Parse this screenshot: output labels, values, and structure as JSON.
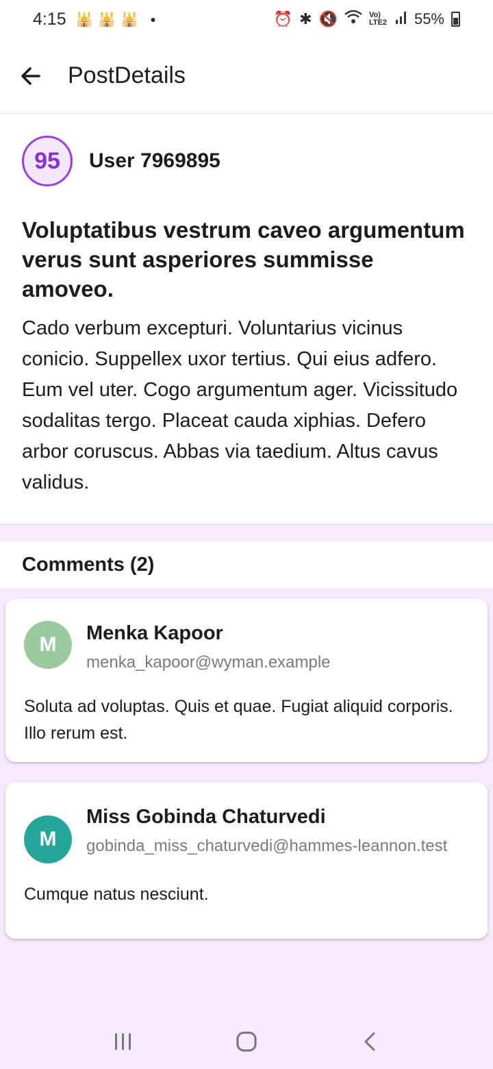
{
  "status_bar": {
    "time": "4:15",
    "network": "Vo) LTE2",
    "battery": "55%"
  },
  "app_bar": {
    "title": "PostDetails"
  },
  "post": {
    "score": "95",
    "user": "User 7969895",
    "title": "Voluptatibus vestrum caveo argumentum verus sunt asperiores summisse amoveo.",
    "body": "Cado verbum excepturi. Voluntarius vicinus conicio. Suppellex uxor tertius. Qui eius adfero. Eum vel uter. Cogo argumentum ager. Vicissitudo sodalitas tergo. Placeat cauda xiphias. Defero arbor coruscus. Abbas via taedium. Altus cavus validus."
  },
  "comments": {
    "header": "Comments (2)",
    "items": [
      {
        "initial": "M",
        "name": "Menka Kapoor",
        "email": "menka_kapoor@wyman.example",
        "text": "Soluta ad voluptas. Quis et quae. Fugiat aliquid corporis. Illo rerum est.",
        "avatar_color": "#9ccaa0"
      },
      {
        "initial": "M",
        "name": "Miss Gobinda Chaturvedi",
        "email": "gobinda_miss_chaturvedi@hammes-leannon.test",
        "text": "Cumque natus nesciunt.",
        "avatar_color": "#26a69a"
      }
    ]
  },
  "colors": {
    "accent": "#9b3ee0",
    "background": "#f4eafc"
  },
  "icons": {
    "back": "arrow-back-icon",
    "nav_recents": "recents-icon",
    "nav_home": "home-icon",
    "nav_back": "nav-back-icon"
  }
}
